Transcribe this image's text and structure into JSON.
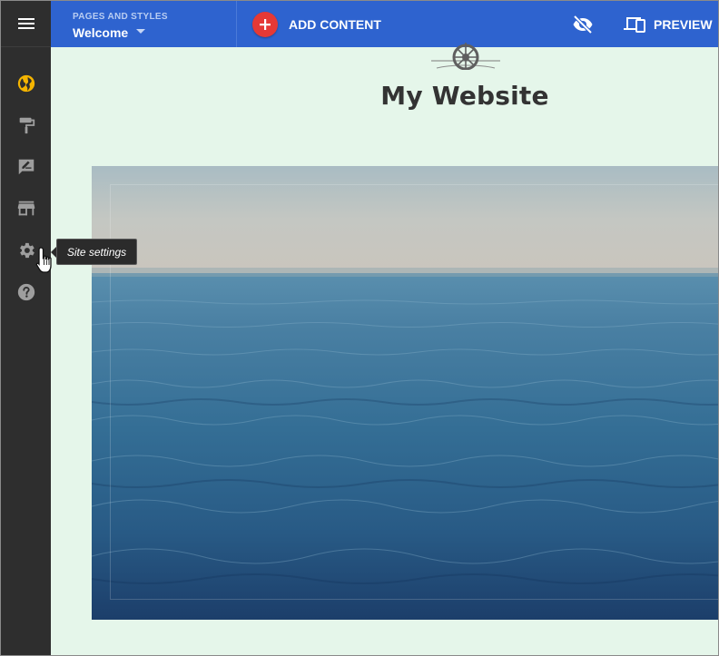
{
  "topbar": {
    "pages_label": "PAGES AND STYLES",
    "current_page": "Welcome",
    "add_content_label": "ADD CONTENT",
    "preview_label": "PREVIEW"
  },
  "sidebar": {
    "items": [
      {
        "name": "globe-icon",
        "color": "#f4b400"
      },
      {
        "name": "paint-roller-icon",
        "color": "#9e9e9e"
      },
      {
        "name": "edit-note-icon",
        "color": "#9e9e9e"
      },
      {
        "name": "store-icon",
        "color": "#9e9e9e"
      },
      {
        "name": "gear-icon",
        "color": "#9e9e9e"
      },
      {
        "name": "help-icon",
        "color": "#9e9e9e"
      }
    ]
  },
  "tooltip": {
    "text": "Site settings"
  },
  "canvas": {
    "site_title": "My Website"
  },
  "colors": {
    "topbar": "#2e63cf",
    "sidebar": "#2e2e2e",
    "accent_add": "#e53935",
    "globe": "#f4b400",
    "canvas_bg": "#e5f6ea"
  }
}
